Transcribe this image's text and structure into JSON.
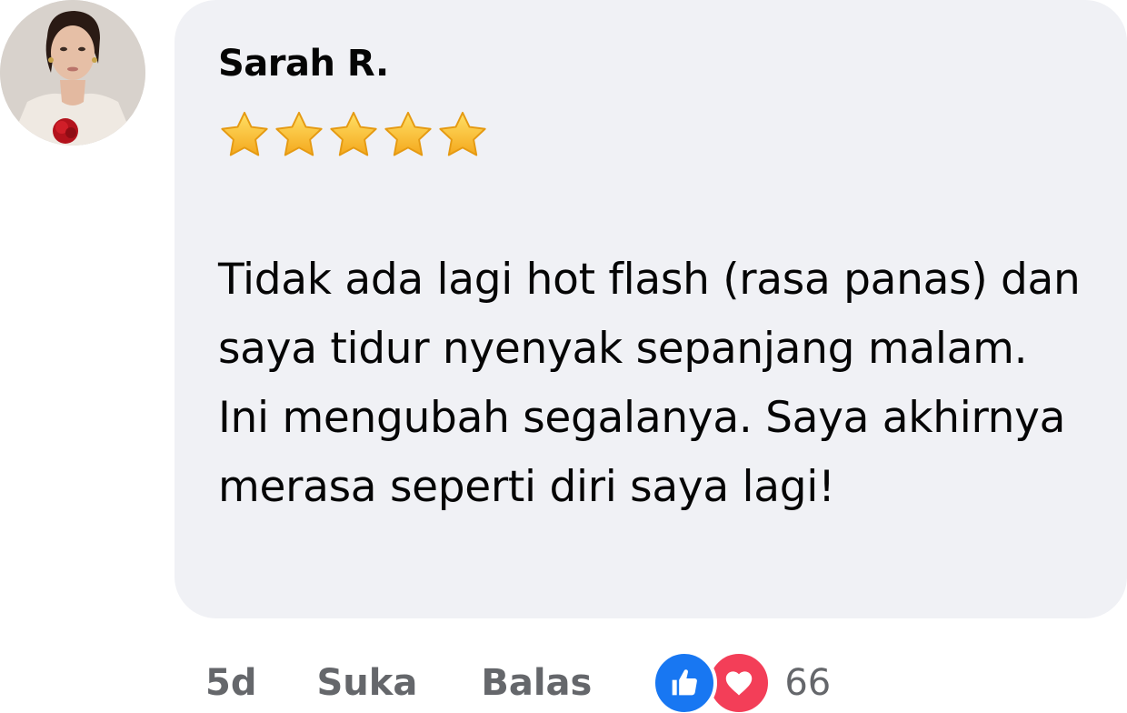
{
  "comment": {
    "author": "Sarah R.",
    "rating": 5,
    "rating_stars": "⭐⭐⭐⭐⭐",
    "text": "Tidak ada lagi hot flash (rasa panas) dan saya tidur nyenyak sepanjang malam. Ini mengubah segalanya. Saya akhirnya merasa seperti diri saya lagi!",
    "time": "5d",
    "like_label": "Suka",
    "reply_label": "Balas",
    "reactions": {
      "icons": [
        "like-icon",
        "love-icon"
      ],
      "count": "66"
    }
  },
  "colors": {
    "bubble": "#f0f1f5",
    "text": "#050505",
    "secondary": "#65676b",
    "like": "#1877f2",
    "love": "#f33e58",
    "star": "#ffcc33"
  }
}
